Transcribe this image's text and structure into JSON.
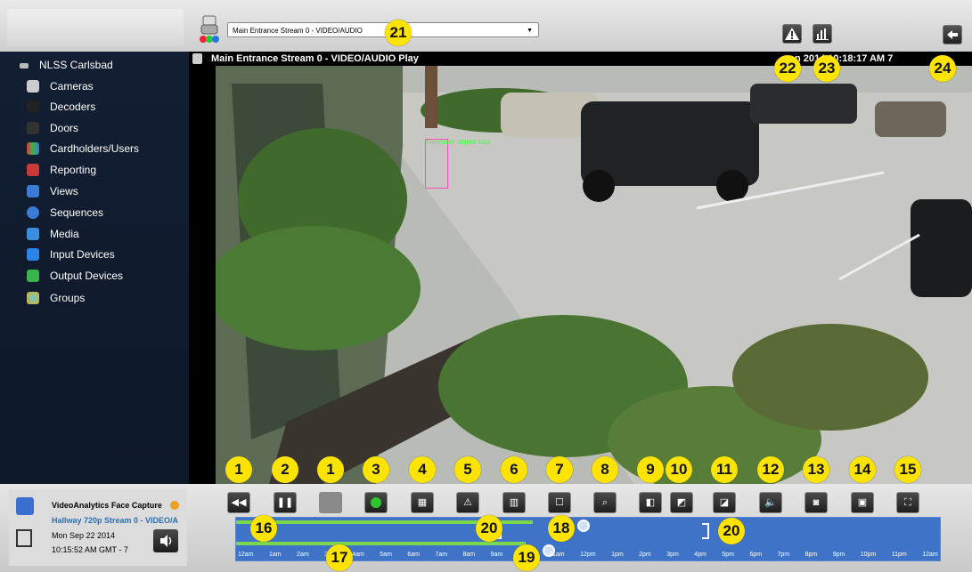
{
  "top": {
    "stream_select_value": "Main Entrance Stream 0 - VIDEO/AUDIO",
    "alerts_icon": "warning-icon",
    "stats_icon": "bar-chart-icon",
    "back_icon": "arrow-left-icon"
  },
  "sidebar": {
    "root_label": "NLSS Carlsbad",
    "items": [
      {
        "label": "Cameras",
        "icon": "camera-icon",
        "color": "#cccccc"
      },
      {
        "label": "Decoders",
        "icon": "decoder-icon",
        "color": "#222222"
      },
      {
        "label": "Doors",
        "icon": "door-icon",
        "color": "#333333"
      },
      {
        "label": "Cardholders/Users",
        "icon": "users-icon",
        "color": "#d93b3b"
      },
      {
        "label": "Reporting",
        "icon": "report-icon",
        "color": "#c83a3a"
      },
      {
        "label": "Views",
        "icon": "views-icon",
        "color": "#3a7bd5"
      },
      {
        "label": "Sequences",
        "icon": "sequence-icon",
        "color": "#3a7bd5"
      },
      {
        "label": "Media",
        "icon": "media-icon",
        "color": "#3a8ee0"
      },
      {
        "label": "Input Devices",
        "icon": "input-arrow-icon",
        "color": "#2a83e6"
      },
      {
        "label": "Output Devices",
        "icon": "output-arrow-icon",
        "color": "#3ab54a"
      },
      {
        "label": "Groups",
        "icon": "globe-icon",
        "color": "#e0a92b"
      }
    ]
  },
  "video": {
    "title": "Main Entrance Stream 0 - VIDEO/AUDIO Play",
    "timestamp": "n        2014 10:18:17 AM      7",
    "overlay_label": "minimum object size"
  },
  "status": {
    "title": "VideoAnalytics Face Capture",
    "stream": "Hallway 720p Stream 0 - VIDEO/A",
    "date": "Mon Sep 22 2014",
    "time": "10:15:52 AM GMT - 7"
  },
  "timeline": {
    "ticks": [
      "12am",
      "1am",
      "2am",
      "3am",
      "4am",
      "5am",
      "6am",
      "7am",
      "8am",
      "9am",
      "10am",
      "11am",
      "12pm",
      "1pm",
      "2pm",
      "3pm",
      "4pm",
      "5pm",
      "6pm",
      "7pm",
      "8pm",
      "9pm",
      "10pm",
      "11pm",
      "12am"
    ]
  },
  "controls": [
    {
      "icon": "rewind-icon"
    },
    {
      "icon": "pause-icon"
    },
    {
      "icon": "disabled-icon"
    },
    {
      "icon": "record-icon"
    },
    {
      "icon": "calendar-icon"
    },
    {
      "icon": "warning-icon"
    },
    {
      "icon": "book-icon"
    },
    {
      "icon": "person-icon"
    },
    {
      "icon": "zoom-box-icon"
    },
    {
      "icon": "camera-move-icon"
    },
    {
      "icon": "camera-tilt-icon"
    },
    {
      "icon": "camera-ptz-icon"
    },
    {
      "icon": "speaker-icon"
    },
    {
      "icon": "snapshot-icon"
    },
    {
      "icon": "save-icon"
    },
    {
      "icon": "fullscreen-icon"
    }
  ],
  "badges": [
    "21",
    "22",
    "23",
    "24",
    "1",
    "2",
    "1",
    "3",
    "4",
    "5",
    "6",
    "7",
    "8",
    "9",
    "10",
    "11",
    "12",
    "13",
    "14",
    "15",
    "16",
    "20",
    "18",
    "20",
    "17",
    "19"
  ]
}
